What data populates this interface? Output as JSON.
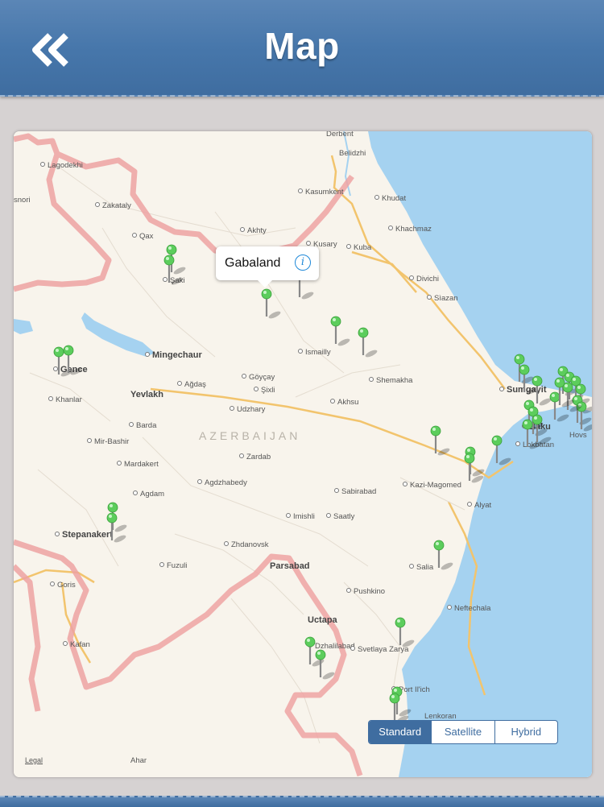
{
  "header": {
    "title": "Map",
    "back_icon": "double-chevron-left-icon"
  },
  "map": {
    "country_label": "AZERBAIJAN",
    "callout": {
      "title": "Gabaland",
      "icon": "info-icon"
    },
    "map_types": [
      "Standard",
      "Satellite",
      "Hybrid"
    ],
    "selected_type": "Standard",
    "legal_label": "Legal",
    "colors": {
      "land": "#f8f4ec",
      "water": "#a5d2f0",
      "border": "#eea3a3",
      "road": "#f2c46d",
      "pin": "#5ccd5c",
      "header": "#4777ab"
    },
    "cities": [
      {
        "name": "Derbent"
      },
      {
        "name": "Belidzhi"
      },
      {
        "name": "Lagodekhi"
      },
      {
        "name": "Kasumkent"
      },
      {
        "name": "Khudat"
      },
      {
        "name": "snori"
      },
      {
        "name": "Zakataly"
      },
      {
        "name": "Khachmaz"
      },
      {
        "name": "Akhty"
      },
      {
        "name": "Qax"
      },
      {
        "name": "Kusary"
      },
      {
        "name": "Kuba"
      },
      {
        "name": "Şaki"
      },
      {
        "name": "Divichi"
      },
      {
        "name": "Sìazan"
      },
      {
        "name": "Mingechaur"
      },
      {
        "name": "Ismailly"
      },
      {
        "name": "Gence"
      },
      {
        "name": "Göyçay"
      },
      {
        "name": "Shemakha"
      },
      {
        "name": "Ağdaş"
      },
      {
        "name": "Şixli"
      },
      {
        "name": "Yevlakh"
      },
      {
        "name": "Khanlar"
      },
      {
        "name": "Akhsu"
      },
      {
        "name": "Sumgayit"
      },
      {
        "name": "Udzhary"
      },
      {
        "name": "Baku"
      },
      {
        "name": "Barda"
      },
      {
        "name": "Lokbatan"
      },
      {
        "name": "Hovs"
      },
      {
        "name": "Mir-Bashir"
      },
      {
        "name": "Zardab"
      },
      {
        "name": "Mardakert"
      },
      {
        "name": "Kazi-Magomed"
      },
      {
        "name": "Agdzhabedy"
      },
      {
        "name": "Sabirabad"
      },
      {
        "name": "Agdam"
      },
      {
        "name": "Alyat"
      },
      {
        "name": "Imishli"
      },
      {
        "name": "Saatly"
      },
      {
        "name": "Stepanakert"
      },
      {
        "name": "Zhdanovsk"
      },
      {
        "name": "Parsabad"
      },
      {
        "name": "Fuzuli"
      },
      {
        "name": "Salia"
      },
      {
        "name": "Goris"
      },
      {
        "name": "Pushkino"
      },
      {
        "name": "Neftechala"
      },
      {
        "name": "Uctapa"
      },
      {
        "name": "Kafan"
      },
      {
        "name": "Dzhalilabad"
      },
      {
        "name": "Svetlaya Zarya"
      },
      {
        "name": "Port Il'ich"
      },
      {
        "name": "Lenkoran"
      },
      {
        "name": "Ahar"
      }
    ]
  }
}
